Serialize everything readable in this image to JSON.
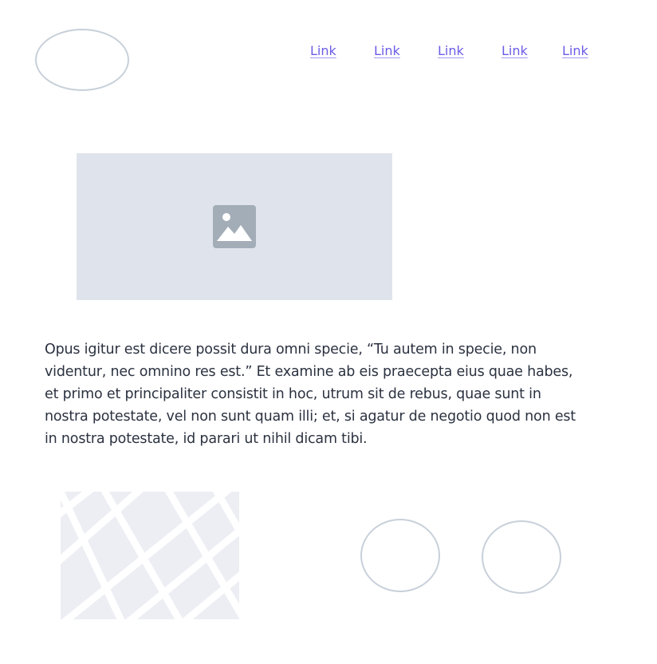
{
  "header": {
    "nav_links": [
      {
        "label": "Link"
      },
      {
        "label": "Link"
      },
      {
        "label": "Link"
      },
      {
        "label": "Link"
      },
      {
        "label": "Link"
      }
    ]
  },
  "hero": {
    "icon": "image-placeholder-icon"
  },
  "content": {
    "paragraph": "Opus igitur est dicere possit dura omni specie, “Tu autem in specie, non videntur, nec omnino res est.” Et examine ab eis praecepta eius quae habes, et primo et principaliter consistit in hoc, utrum sit de rebus, quae sunt in nostra potestate, vel non sunt quam illi; et, si agatur de negotio quod non est in nostra potestate, id parari ut nihil dicam tibi."
  },
  "colors": {
    "link": "#6c5ce7",
    "placeholder_bg": "#dfe4ec",
    "outline": "#c8d0da",
    "text": "#2b3240"
  }
}
